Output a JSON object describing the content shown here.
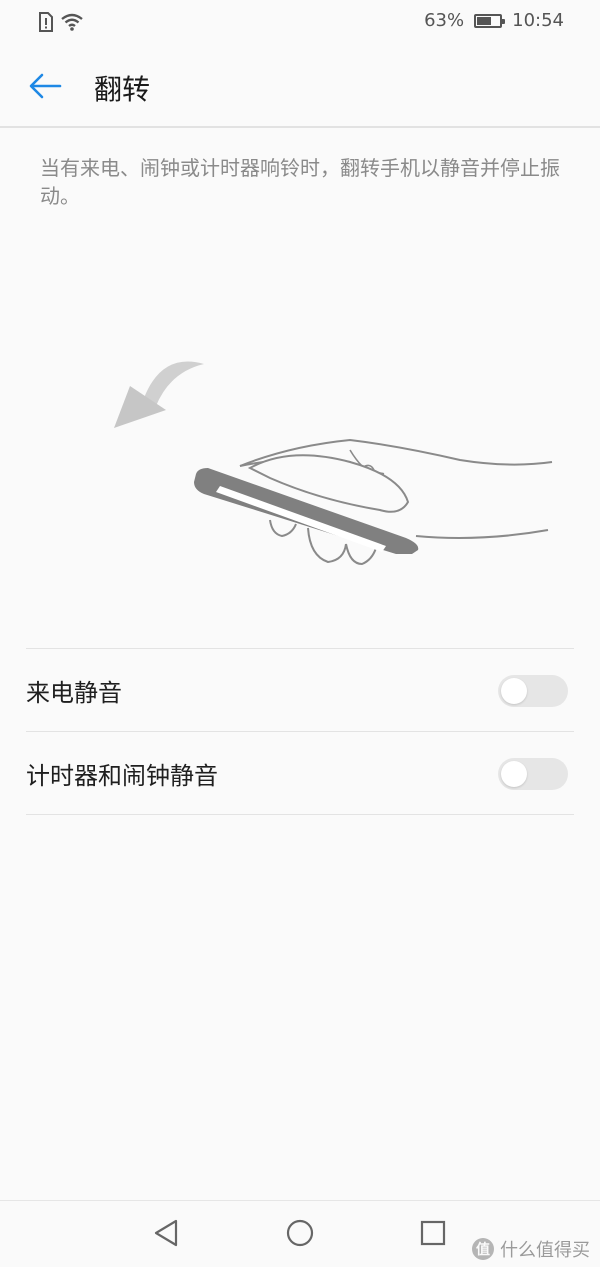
{
  "status_bar": {
    "battery_percent": "63%",
    "battery_level": 0.63,
    "time": "10:54",
    "icons": [
      "sim-alert-icon",
      "wifi-icon",
      "battery-icon"
    ]
  },
  "header": {
    "title": "翻转",
    "back_icon": "arrow-left-icon",
    "accent_color": "#1e88e5"
  },
  "description": "当有来电、闹钟或计时器响铃时，翻转手机以静音并停止振动。",
  "illustration": {
    "icon": "flip-phone-hand-illustration"
  },
  "settings": [
    {
      "label": "来电静音",
      "enabled": false
    },
    {
      "label": "计时器和闹钟静音",
      "enabled": false
    }
  ],
  "nav_bar": {
    "back_icon": "triangle-back-icon",
    "home_icon": "circle-home-icon",
    "recents_icon": "square-recents-icon"
  },
  "watermark": {
    "logo_text": "值",
    "text": "什么值得买"
  }
}
